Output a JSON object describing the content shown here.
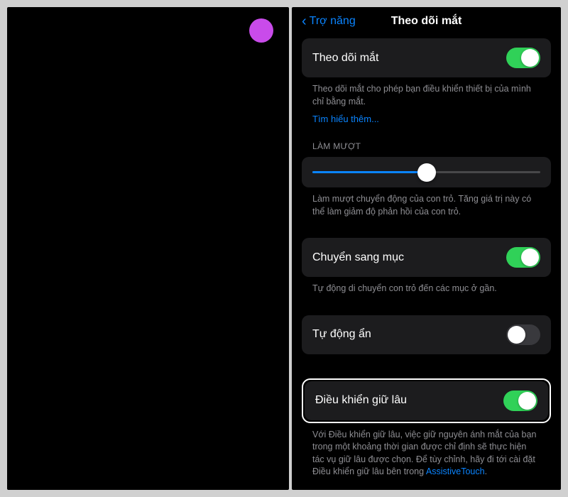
{
  "nav": {
    "back_label": "Trợ năng",
    "title": "Theo dõi mắt"
  },
  "eye_tracking": {
    "label": "Theo dõi mắt",
    "enabled": true,
    "description": "Theo dõi mắt cho phép bạn điều khiển thiết bị của mình chỉ bằng mắt.",
    "learn_more": "Tìm hiểu thêm..."
  },
  "smoothing": {
    "section_label": "LÀM MƯỢT",
    "value": 50,
    "description": "Làm mượt chuyển động của con trỏ. Tăng giá trị này có thể làm giảm độ phản hồi của con trỏ."
  },
  "snap_to_item": {
    "label": "Chuyển sang mục",
    "enabled": true,
    "description": "Tự động di chuyển con trỏ đến các mục ở gần."
  },
  "auto_hide": {
    "label": "Tự động ẩn",
    "enabled": false
  },
  "dwell_control": {
    "label": "Điều khiển giữ lâu",
    "enabled": true,
    "description": "Với Điều khiển giữ lâu, việc giữ nguyên ánh mắt của bạn trong một khoảng thời gian được chỉ định sẽ thực hiện tác vụ giữ lâu được chọn. Để tùy chỉnh, hãy đi tới cài đặt Điều khiển giữ lâu bên trong ",
    "link_label": "AssistiveTouch",
    "suffix": "."
  }
}
